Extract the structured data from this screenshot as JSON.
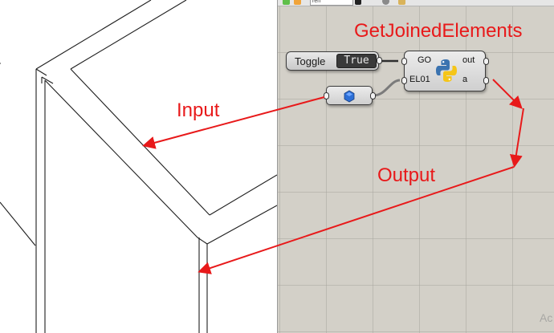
{
  "toolbar": {
    "field_text": "ren"
  },
  "components": {
    "toggle": {
      "label": "Toggle",
      "value": "True"
    },
    "python": {
      "inputs": [
        "GO",
        "EL01"
      ],
      "outputs": [
        "out",
        "a"
      ],
      "icon": "python-icon"
    },
    "parameter": {
      "icon": "revit-element-icon"
    }
  },
  "annotations": {
    "title": "GetJoinedElements",
    "input": "Input",
    "output": "Output"
  },
  "watermark": "Ac",
  "colors": {
    "annotation": "#e8191a",
    "canvas": "#d3d0c8",
    "toggle_value_bg": "#3a3a3a",
    "python_blue": "#3b73b0",
    "python_yellow": "#f5c518",
    "param_icon": "#2d6fd6"
  }
}
